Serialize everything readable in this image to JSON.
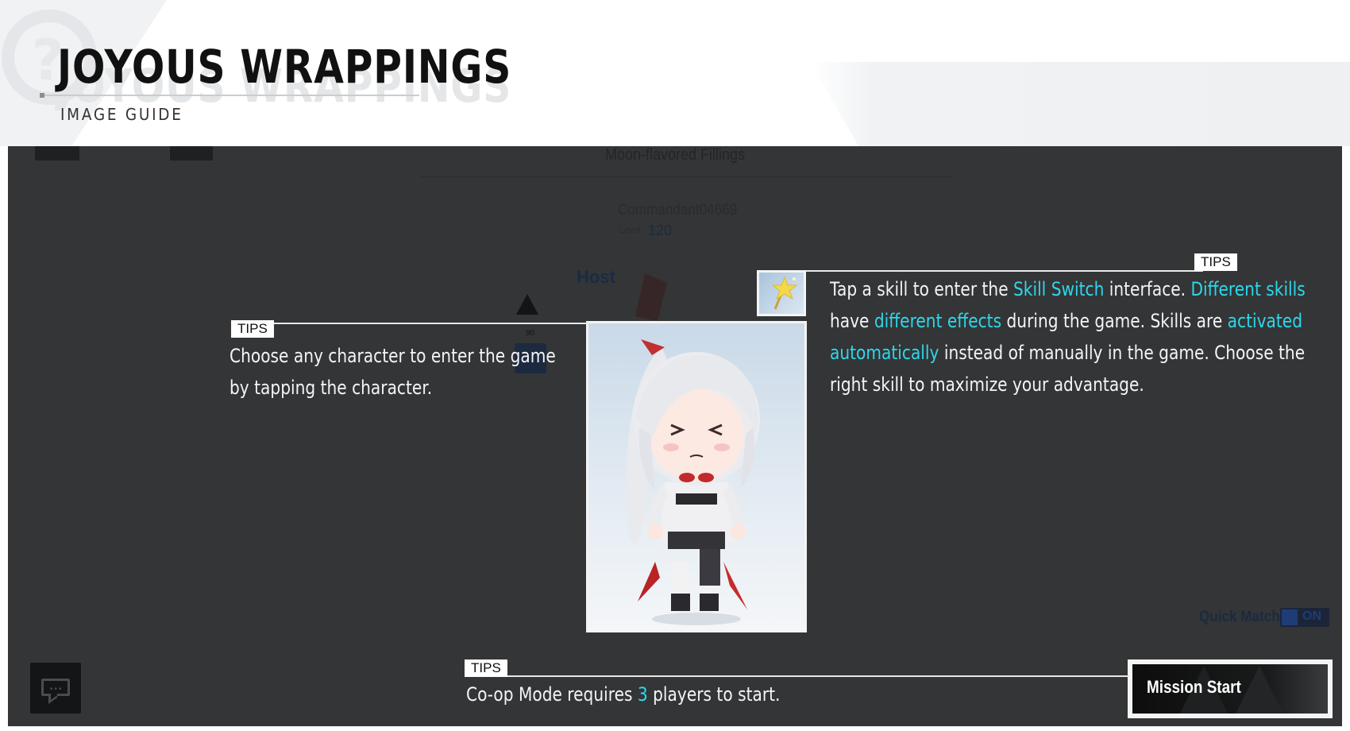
{
  "header": {
    "title": "JOYOUS WRAPPINGS",
    "subtitle": "IMAGE GUIDE"
  },
  "background_ui": {
    "room_title": "Moon-flavored Fillings",
    "commander_name": "Commandant04669",
    "level_label": "Level",
    "level_value": "120",
    "host_label": "Host",
    "character_level": "90",
    "quick_match_label": "Quick Match",
    "quick_match_toggle": "ON"
  },
  "tips": {
    "badge_label": "TIPS",
    "character_tip": "Choose any character to enter the game by tapping the character.",
    "skill_tip": {
      "part1": "Tap a skill to enter the ",
      "hl1": "Skill Switch",
      "part2": " interface. ",
      "hl2": "Different skills",
      "part3": " have ",
      "hl3": "different effects",
      "part4": " during the game. Skills are ",
      "hl4": "activated automatically",
      "part5": " instead of manually in the game. Choose the right skill to maximize your advantage."
    },
    "coop_tip": {
      "part1": "Co-op Mode requires ",
      "hl1": "3",
      "part2": " players to start."
    }
  },
  "mission_button": {
    "label": "Mission Start"
  },
  "icons": {
    "skill": "star-wand-icon",
    "chat": "chat-bubble-icon",
    "character": "chibi-character-portrait"
  },
  "colors": {
    "highlight": "#2ed7ea",
    "overlay": "#333537",
    "tip_text": "#f4f4f4"
  }
}
